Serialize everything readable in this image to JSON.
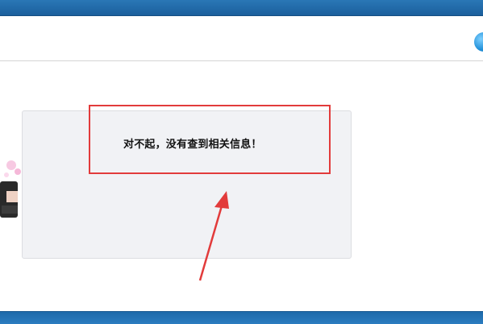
{
  "message": {
    "text": "对不起，没有查到相关信息！"
  },
  "colors": {
    "top_bar": "#1b5f9c",
    "bottom_bar": "#2b7cc0",
    "panel_bg": "#f1f2f5",
    "highlight": "#e23b3b"
  },
  "icons": {
    "header_right": "round-globe-icon",
    "annotation_arrow": "red-arrow-icon"
  }
}
